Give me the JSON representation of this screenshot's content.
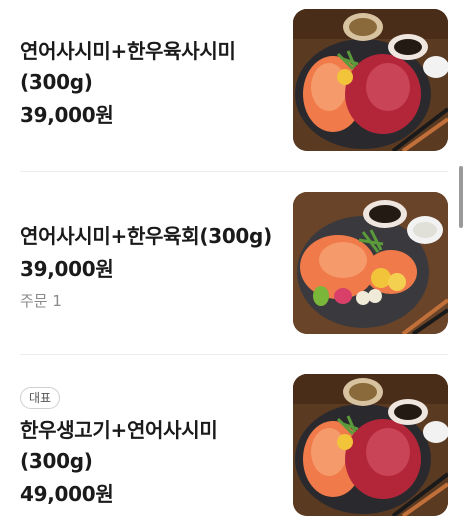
{
  "menu": {
    "items": [
      {
        "name_line1": "연어사시미+한우육사시미",
        "name_line2": "(300g)",
        "price": "39,000원",
        "image": "salmon-beef-sashimi-platter"
      },
      {
        "name_line1": "연어사시미+한우육회(300g)",
        "price": "39,000원",
        "orders": "주문 1",
        "image": "salmon-beef-yukhoe-platter"
      },
      {
        "badge": "대표",
        "name_line1": "한우생고기+연어사시미",
        "name_line2": "(300g)",
        "price": "49,000원",
        "image": "beef-salmon-sashimi-platter"
      }
    ]
  },
  "colors": {
    "text_primary": "#1a1a1a",
    "text_secondary": "#8a8a8a",
    "divider": "#ececec",
    "salmon": "#f07a4a",
    "beef": "#b3263a",
    "plate": "#2a2a2e",
    "table_wood": "#5b3a22"
  }
}
